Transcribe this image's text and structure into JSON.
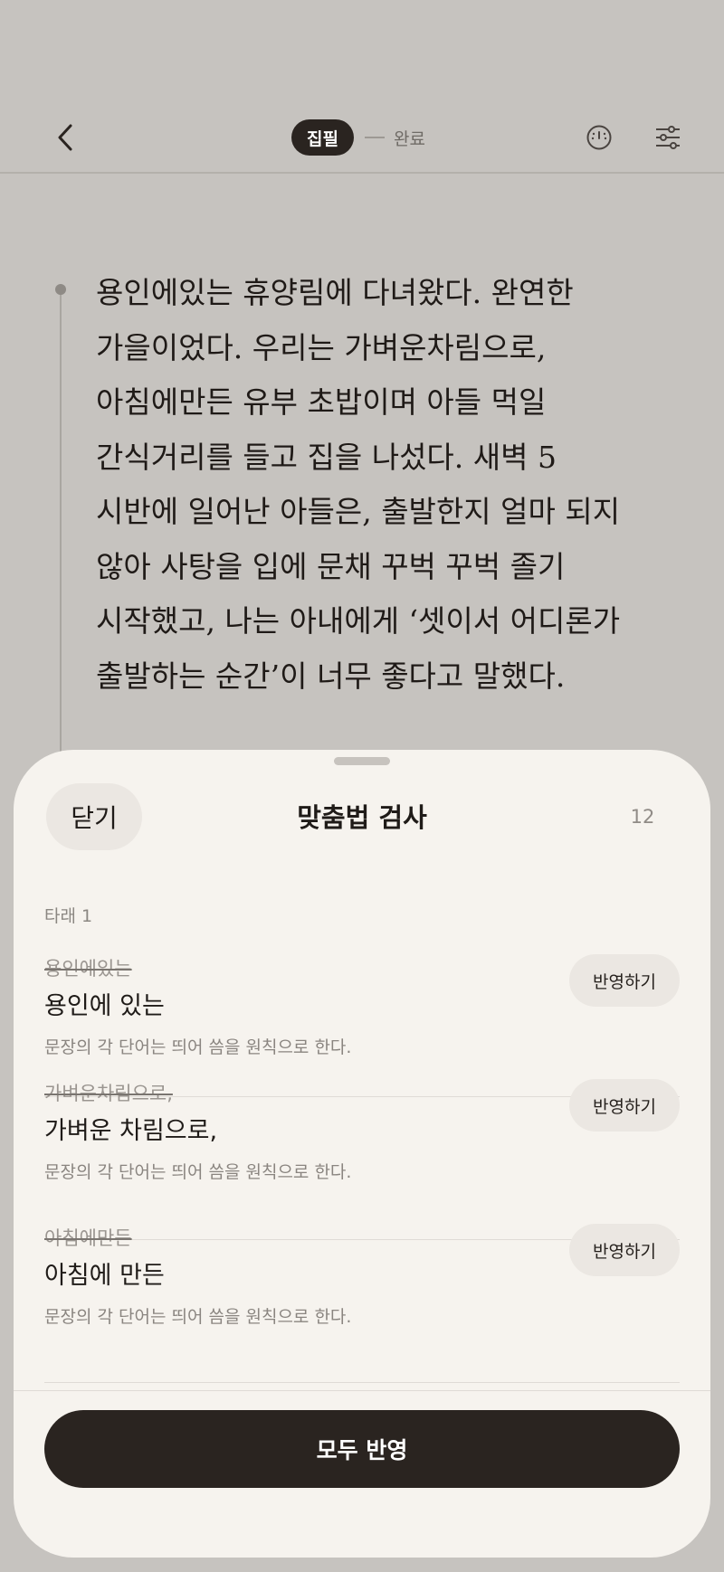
{
  "header": {
    "back_icon": "chevron-left-icon",
    "step_active": "집필",
    "step_next": "완료",
    "gauge_icon": "gauge-icon",
    "settings_icon": "sliders-icon"
  },
  "editor": {
    "lines": [
      "용인에있는 휴양림에 다녀왔다. 완연한",
      "가을이었다. 우리는 가벼운차림으로,",
      "아침에만든 유부 초밥이며 아들 먹일",
      "간식거리를 들고 집을 나섰다. 새벽 5",
      "시반에 일어난 아들은, 출발한지 얼마 되지",
      "않아 사탕을 입에 문채 꾸벅 꾸벅 졸기",
      "시작했고, 나는 아내에게 ‘셋이서 어디론가",
      "출발하는 순간’이 너무 좋다고 말했다."
    ]
  },
  "sheet": {
    "close_label": "닫기",
    "title": "맞춤법 검사",
    "count": "12",
    "section_label": "타래 1",
    "items": [
      {
        "original": "용인에있는",
        "corrected": "용인에 있는",
        "note": "문장의 각 단어는 띄어 씀을 원칙으로 한다.",
        "apply_label": "반영하기"
      },
      {
        "original": "가벼운차림으로,",
        "corrected": "가벼운 차림으로,",
        "note": "문장의 각 단어는 띄어 씀을 원칙으로 한다.",
        "apply_label": "반영하기"
      },
      {
        "original": "아침에만든",
        "corrected": "아침에 만든",
        "note": "문장의 각 단어는 띄어 씀을 원칙으로 한다.",
        "apply_label": "반영하기"
      }
    ],
    "apply_all_label": "모두 반영"
  }
}
